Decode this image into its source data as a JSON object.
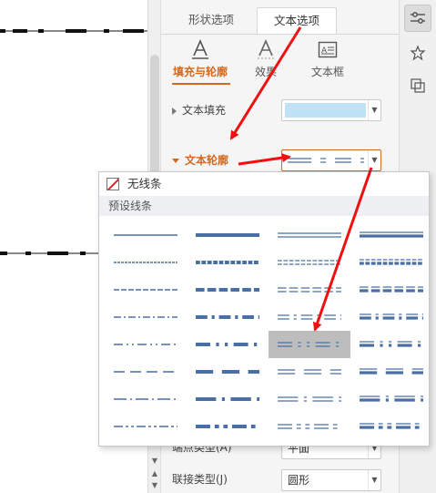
{
  "panel": {
    "tabs": [
      {
        "label": "形状选项",
        "active": false
      },
      {
        "label": "文本选项",
        "active": true
      }
    ],
    "subtabs": [
      {
        "label": "填充与轮廓",
        "icon": "text-fill-icon",
        "active": true
      },
      {
        "label": "效果",
        "icon": "text-effect-icon",
        "active": false
      },
      {
        "label": "文本框",
        "icon": "textbox-icon",
        "active": false
      }
    ],
    "text_fill_label": "文本填充",
    "text_fill_color": "#bfe2f5",
    "text_outline_label": "文本轮廓",
    "cap_type_label": "端点类型(A)",
    "cap_type_value": "平面",
    "join_type_label": "联接类型(J)",
    "join_type_value": "圆形"
  },
  "popup": {
    "no_line_label": "无线条",
    "preset_header": "预设线条",
    "line_color": "#4a6fa5",
    "selected_index": 18
  },
  "rail": {
    "icons": [
      "properties-icon",
      "pin-icon",
      "selection-icon"
    ]
  },
  "colors": {
    "accent": "#d2691e",
    "annotation": "#f01010",
    "selected_cell": "#bdbdbd"
  }
}
